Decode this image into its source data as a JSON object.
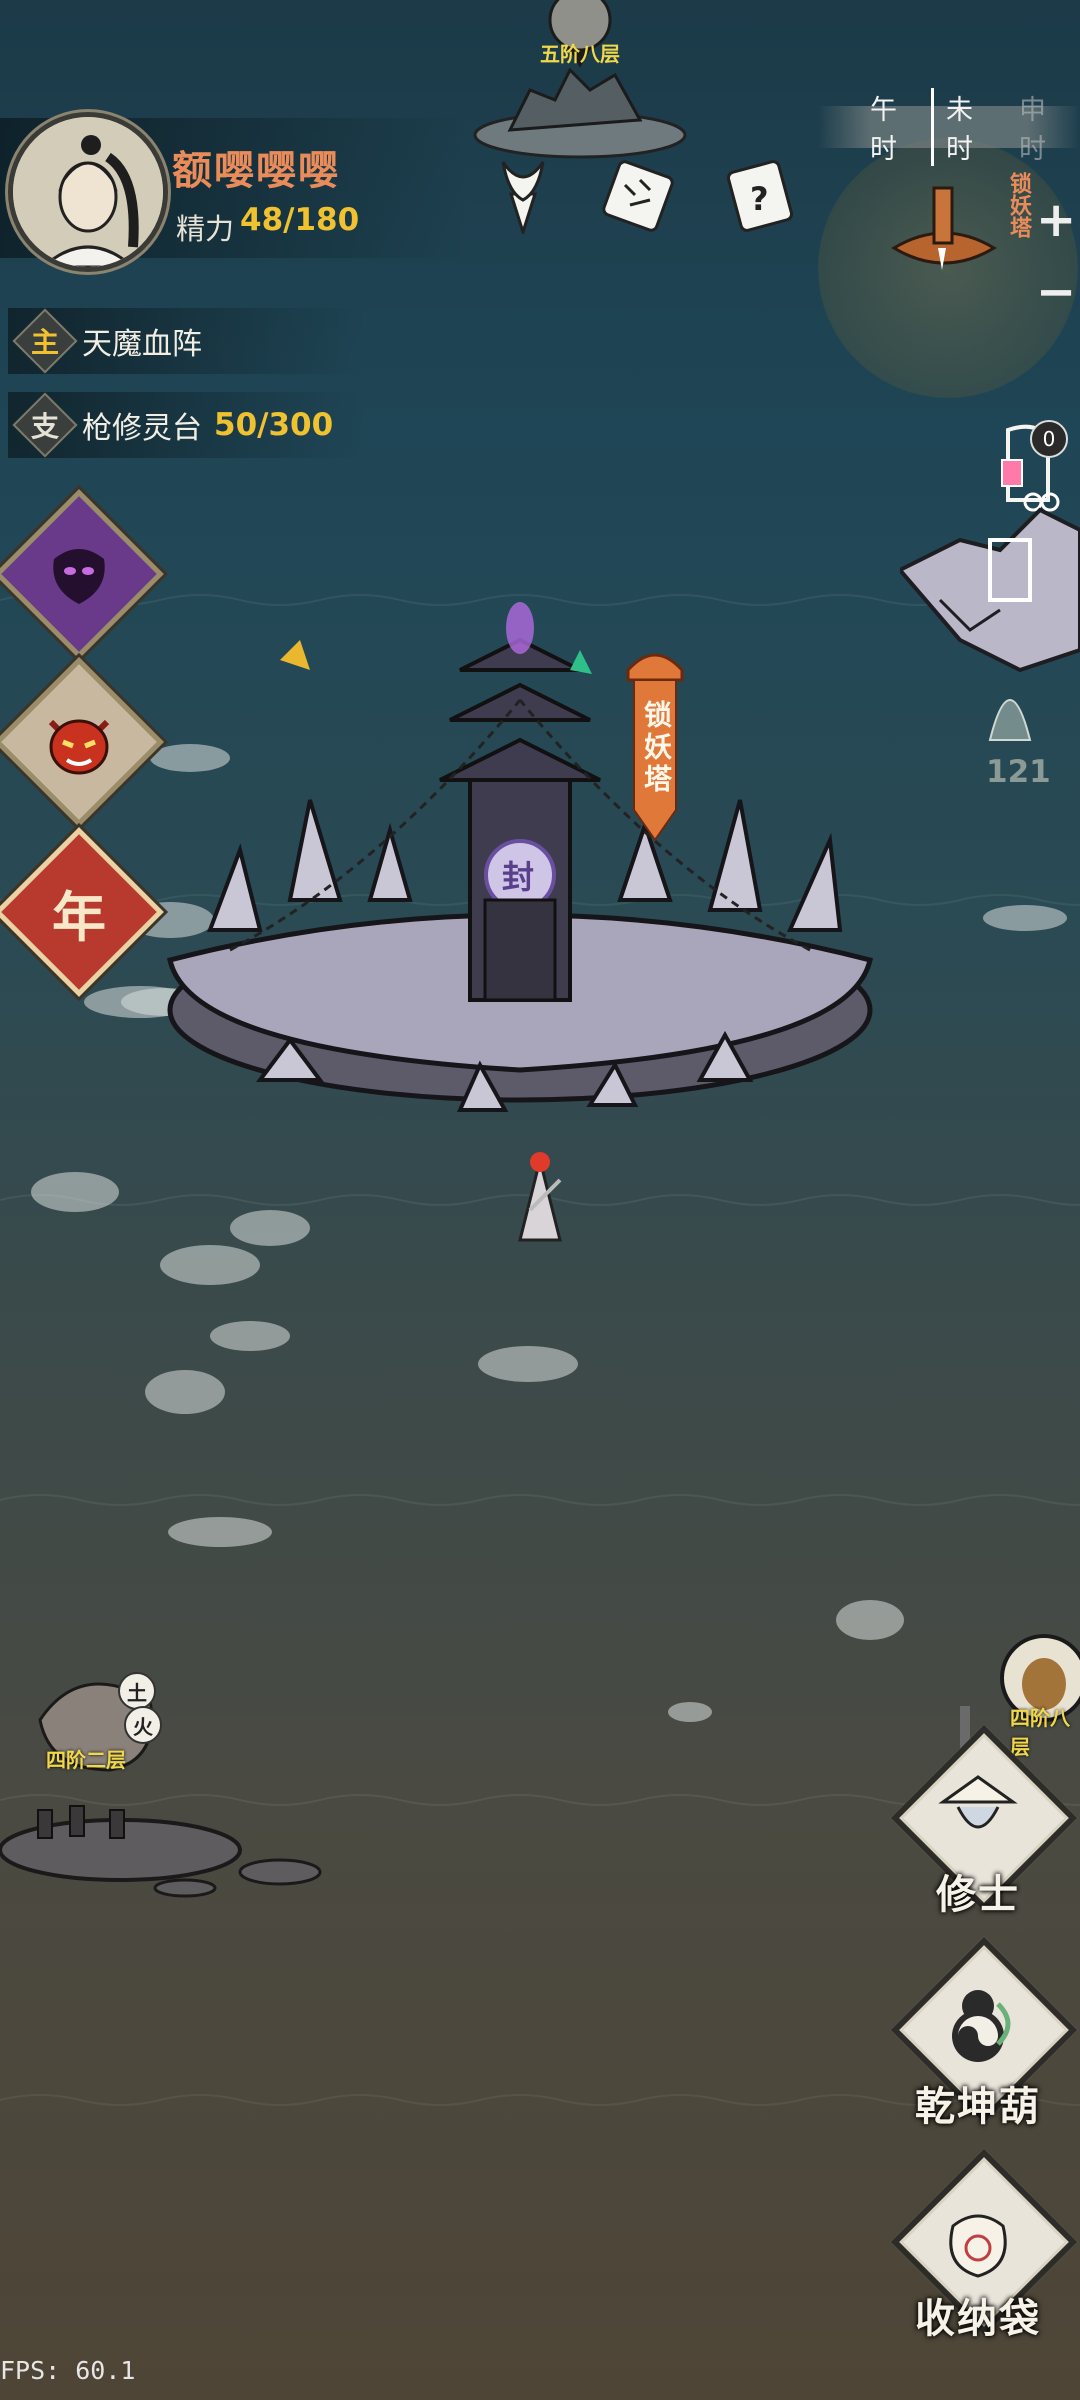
{
  "player": {
    "name": "额嘤嘤嘤",
    "stamina_label": "精力",
    "stamina_value": "48/180"
  },
  "quests": {
    "main": {
      "badge": "主",
      "title": "天魔血阵"
    },
    "side": {
      "badge": "支",
      "title": "枪修灵台",
      "progress": "50/300"
    }
  },
  "event_icons": [
    "demon-skull-icon",
    "red-oni-mask-icon",
    "year-icon"
  ],
  "event_year_label": "年",
  "toolbar_icons": [
    "torch-icon",
    "scroll-manual-icon",
    "scroll-quest-icon"
  ],
  "time_bar": {
    "segments": [
      "午时",
      "未时",
      "申时"
    ],
    "active": "未时",
    "current_marker": "午时"
  },
  "minimap": {
    "label": "锁妖塔",
    "zoom_in": "+",
    "zoom_out": "−"
  },
  "lantern_count": "0",
  "spirit_count": "121",
  "tower": {
    "banner": "锁妖塔",
    "seal": "封"
  },
  "map_nodes": {
    "top": "五阶八层",
    "left": "四阶二层",
    "left_elements": [
      "土",
      "火"
    ],
    "right": "四阶八层"
  },
  "side_buttons": [
    {
      "label": "修士",
      "icon": "cultivator-icon"
    },
    {
      "label": "乾坤葫",
      "icon": "gourd-icon"
    },
    {
      "label": "收纳袋",
      "icon": "storage-bag-icon"
    }
  ],
  "fps": "FPS: 60.1",
  "colors": {
    "name": "#e98c5a",
    "accent": "#f0c230",
    "banner": "#e0783a",
    "node_tag": "#f0d84a"
  }
}
